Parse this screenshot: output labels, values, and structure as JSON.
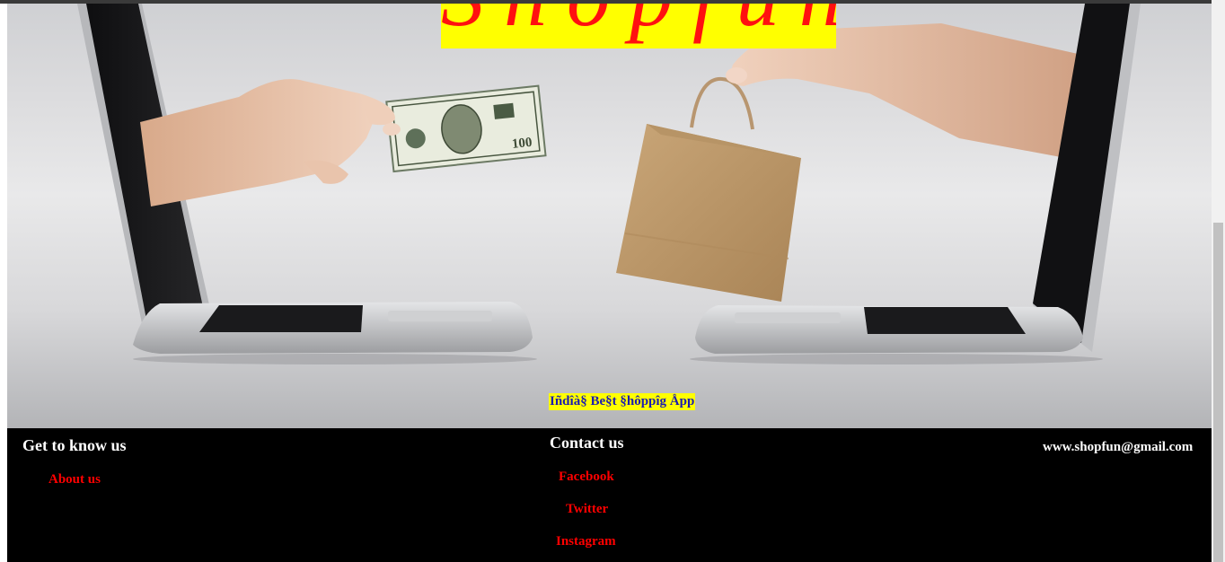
{
  "hero": {
    "logo_text": "Shopfun",
    "tagline": "Iñdîà§ Be§t §hôppîg Åpp",
    "image_icon": "laptops-hands-exchange-illustration"
  },
  "footer": {
    "left": {
      "heading": "Get to know us",
      "links": [
        "About us"
      ]
    },
    "center": {
      "heading": "Contact us",
      "links": [
        "Facebook",
        "Twitter",
        "Instagram"
      ]
    },
    "right": {
      "email": "www.shopfun@gmail.com"
    }
  },
  "colors": {
    "logo_bg": "#ffff00",
    "logo_text": "#ff1010",
    "tagline_text": "#1c1cb0",
    "footer_bg": "#000000",
    "footer_link": "#ff0000",
    "footer_heading": "#ffffff"
  },
  "scrollbar": {
    "position_fraction": 0.4
  }
}
